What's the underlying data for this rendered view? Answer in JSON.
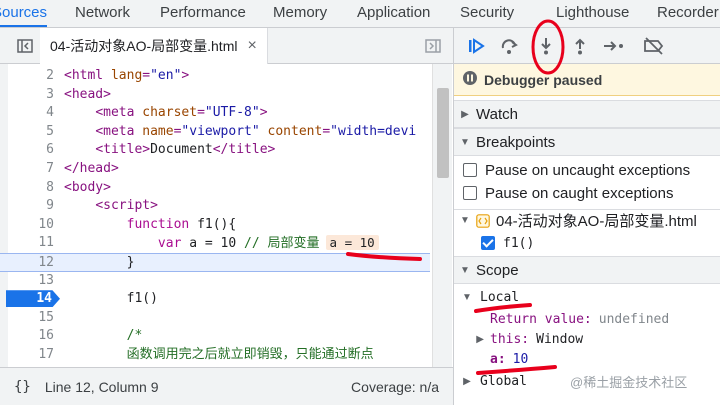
{
  "top_tabs": [
    "Sources",
    "Network",
    "Performance",
    "Memory",
    "Application",
    "Security",
    "Lighthouse",
    "Recorder"
  ],
  "active_tab": "Sources",
  "file_tab": {
    "name": "04-活动对象AO-局部变量.html",
    "close": "×"
  },
  "code_lines": [
    {
      "n": "2",
      "parts": [
        [
          "t-tag",
          "<html "
        ],
        [
          "t-attr",
          "lang"
        ],
        [
          "t-tag",
          "="
        ],
        [
          "t-str",
          "\"en\""
        ],
        [
          "t-tag",
          ">"
        ]
      ]
    },
    {
      "n": "3",
      "parts": [
        [
          "t-tag",
          "<head>"
        ]
      ]
    },
    {
      "n": "4",
      "parts": [
        [
          "",
          "    "
        ],
        [
          "t-tag",
          "<meta "
        ],
        [
          "t-attr",
          "charset"
        ],
        [
          "t-tag",
          "="
        ],
        [
          "t-str",
          "\"UTF-8\""
        ],
        [
          "t-tag",
          ">"
        ]
      ]
    },
    {
      "n": "5",
      "parts": [
        [
          "",
          "    "
        ],
        [
          "t-tag",
          "<meta "
        ],
        [
          "t-attr",
          "name"
        ],
        [
          "t-tag",
          "="
        ],
        [
          "t-str",
          "\"viewport\" "
        ],
        [
          "t-attr",
          "content"
        ],
        [
          "t-tag",
          "="
        ],
        [
          "t-str",
          "\"width=devi"
        ]
      ]
    },
    {
      "n": "6",
      "parts": [
        [
          "",
          "    "
        ],
        [
          "t-tag",
          "<title>"
        ],
        [
          "",
          "Document"
        ],
        [
          "t-tag",
          "</title>"
        ]
      ]
    },
    {
      "n": "7",
      "parts": [
        [
          "t-tag",
          "</head>"
        ]
      ]
    },
    {
      "n": "8",
      "parts": [
        [
          "t-tag",
          "<body>"
        ]
      ]
    },
    {
      "n": "9",
      "parts": [
        [
          "",
          "    "
        ],
        [
          "t-tag",
          "<script>"
        ]
      ]
    },
    {
      "n": "10",
      "parts": [
        [
          "",
          "        "
        ],
        [
          "t-kw",
          "function "
        ],
        [
          "",
          "f1(){"
        ]
      ]
    },
    {
      "n": "11",
      "parts": [
        [
          "",
          "            "
        ],
        [
          "t-kw",
          "var "
        ],
        [
          "",
          "a = 10 "
        ],
        [
          "t-cmt",
          "// 局部变量"
        ]
      ],
      "inline": "a = 10"
    },
    {
      "n": "12",
      "parts": [
        [
          "",
          "        "
        ],
        [
          "",
          "}"
        ]
      ],
      "current": true
    },
    {
      "n": "13",
      "parts": []
    },
    {
      "n": "14",
      "parts": [
        [
          "",
          "        "
        ],
        [
          "",
          "f1()"
        ]
      ],
      "breakpoint": true
    },
    {
      "n": "15",
      "parts": []
    },
    {
      "n": "16",
      "parts": [
        [
          "",
          "        "
        ],
        [
          "t-cmt",
          "/*"
        ]
      ]
    },
    {
      "n": "17",
      "parts": [
        [
          "",
          "        "
        ],
        [
          "t-cmt",
          "函数调用完之后就立即销毁，只能通过断点"
        ]
      ]
    }
  ],
  "status": {
    "position": "Line 12, Column 9",
    "coverage": "Coverage: n/a"
  },
  "debugger": {
    "paused": "Debugger paused",
    "watch": "Watch",
    "breakpoints": "Breakpoints",
    "pause_uncaught": "Pause on uncaught exceptions",
    "pause_caught": "Pause on caught exceptions",
    "bp_file": "04-活动对象AO-局部变量.html",
    "bp_item": "f1()",
    "scope": "Scope",
    "local": "Local",
    "return_key": "Return value:",
    "return_val": "undefined",
    "this_key": "this:",
    "this_val": "Window",
    "a_key": "a:",
    "a_val": "10",
    "global": "Global"
  },
  "watermark": "@稀土掘金技术社区",
  "colors": {
    "accent": "#1a73e8",
    "annotation": "#e8001c",
    "paused_bg": "#fef7e0"
  }
}
